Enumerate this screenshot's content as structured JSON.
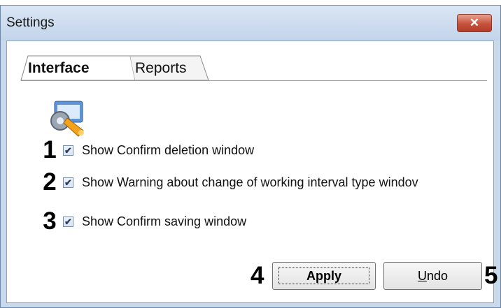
{
  "window": {
    "title": "Settings",
    "close_glyph": "✕"
  },
  "tabs": [
    {
      "label": "Interface",
      "active": true
    },
    {
      "label": "Reports",
      "active": false
    }
  ],
  "options": [
    {
      "marker": "1",
      "label": "Show Confirm deletion window",
      "checked": true
    },
    {
      "marker": "2",
      "label": "Show Warning about change of working interval type windov",
      "checked": true
    },
    {
      "marker": "3",
      "label": "Show Confirm saving window",
      "checked": true
    }
  ],
  "buttons": {
    "apply_marker": "4",
    "apply_label": "Apply",
    "undo_label": "Undo",
    "undo_accesskey": "U",
    "undo_rest": "ndo",
    "undo_marker": "5"
  },
  "icons": {
    "app": "settings-app-icon",
    "check": "✔"
  },
  "colors": {
    "frame": "#c9d9ec",
    "close": "#c6533d"
  }
}
